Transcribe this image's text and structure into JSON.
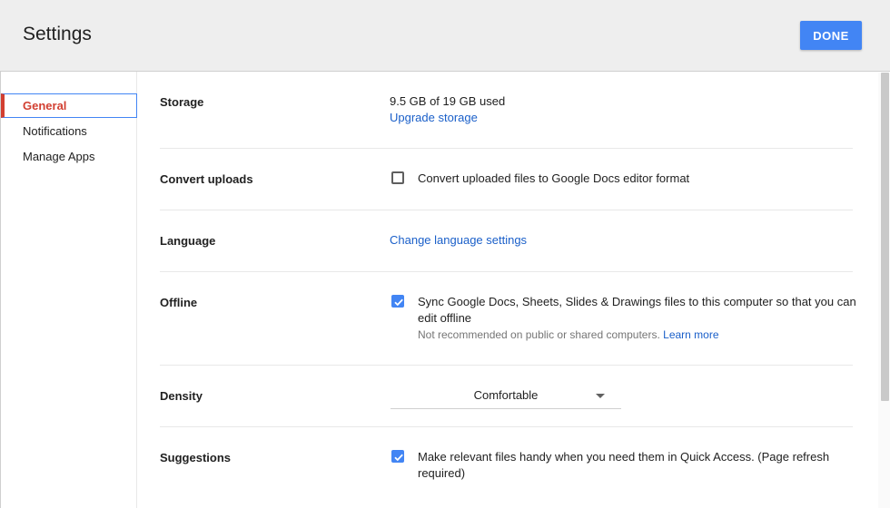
{
  "header": {
    "title": "Settings",
    "done_label": "DONE"
  },
  "sidebar": {
    "items": [
      {
        "label": "General",
        "active": true
      },
      {
        "label": "Notifications",
        "active": false
      },
      {
        "label": "Manage Apps",
        "active": false
      }
    ]
  },
  "settings": {
    "storage": {
      "label": "Storage",
      "usage": "9.5 GB of 19 GB used",
      "link": "Upgrade storage"
    },
    "convert": {
      "label": "Convert uploads",
      "checked": false,
      "text": "Convert uploaded files to Google Docs editor format"
    },
    "language": {
      "label": "Language",
      "link": "Change language settings"
    },
    "offline": {
      "label": "Offline",
      "checked": true,
      "line1": "Sync Google Docs, Sheets, Slides & Drawings files to this computer so that you can",
      "line2": "edit offline",
      "note": "Not recommended on public or shared computers.",
      "note_link": "Learn more"
    },
    "density": {
      "label": "Density",
      "value": "Comfortable"
    },
    "suggestions": {
      "label": "Suggestions",
      "checked": true,
      "line1": "Make relevant files handy when you need them in Quick Access. (Page refresh",
      "line2": "required)"
    }
  },
  "colors": {
    "accent_blue": "#4285f4",
    "active_red": "#d23f31",
    "link_blue": "#1a5fc9"
  }
}
